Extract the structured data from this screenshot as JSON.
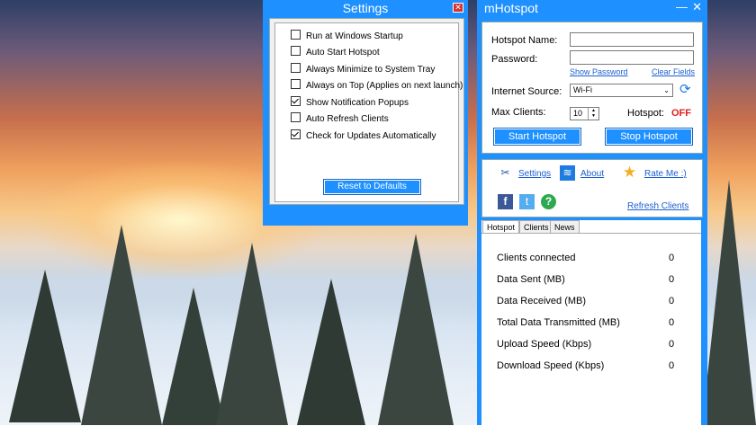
{
  "settings_window": {
    "title": "Settings",
    "options": [
      {
        "label": "Run at Windows Startup",
        "checked": false
      },
      {
        "label": "Auto Start Hotspot",
        "checked": false
      },
      {
        "label": "Always Minimize to System Tray",
        "checked": false
      },
      {
        "label": "Always on Top (Applies on next launch)",
        "checked": false
      },
      {
        "label": "Show Notification Popups",
        "checked": true
      },
      {
        "label": "Auto Refresh Clients",
        "checked": false
      },
      {
        "label": "Check for Updates Automatically",
        "checked": true
      }
    ],
    "reset_label": "Reset to Defaults"
  },
  "mhotspot": {
    "title": "mHotspot",
    "hotspot_name_label": "Hotspot Name:",
    "hotspot_name_value": "",
    "password_label": "Password:",
    "password_value": "",
    "show_password": "Show Password",
    "clear_fields": "Clear Fields",
    "internet_source_label": "Internet Source:",
    "internet_source_value": "Wi-Fi",
    "max_clients_label": "Max Clients:",
    "max_clients_value": "10",
    "hotspot_status_label": "Hotspot:",
    "hotspot_status_value": "OFF",
    "start_label": "Start Hotspot",
    "stop_label": "Stop Hotspot",
    "settings_link": "Settings",
    "about_link": "About",
    "rate_link": "Rate Me :)",
    "refresh_clients_link": "Refresh Clients",
    "tabs": [
      "Hotspot",
      "Clients",
      "News"
    ],
    "stats": [
      {
        "label": "Clients connected",
        "value": "0"
      },
      {
        "label": "Data Sent (MB)",
        "value": "0"
      },
      {
        "label": "Data Received (MB)",
        "value": "0"
      },
      {
        "label": "Total Data Transmitted (MB)",
        "value": "0"
      },
      {
        "label": "Upload Speed (Kbps)",
        "value": "0"
      },
      {
        "label": "Download Speed (Kbps)",
        "value": "0"
      }
    ]
  },
  "colors": {
    "window_blue": "#1e90ff",
    "status_off_red": "#e21b1b",
    "link_blue": "#1a5fd0"
  }
}
